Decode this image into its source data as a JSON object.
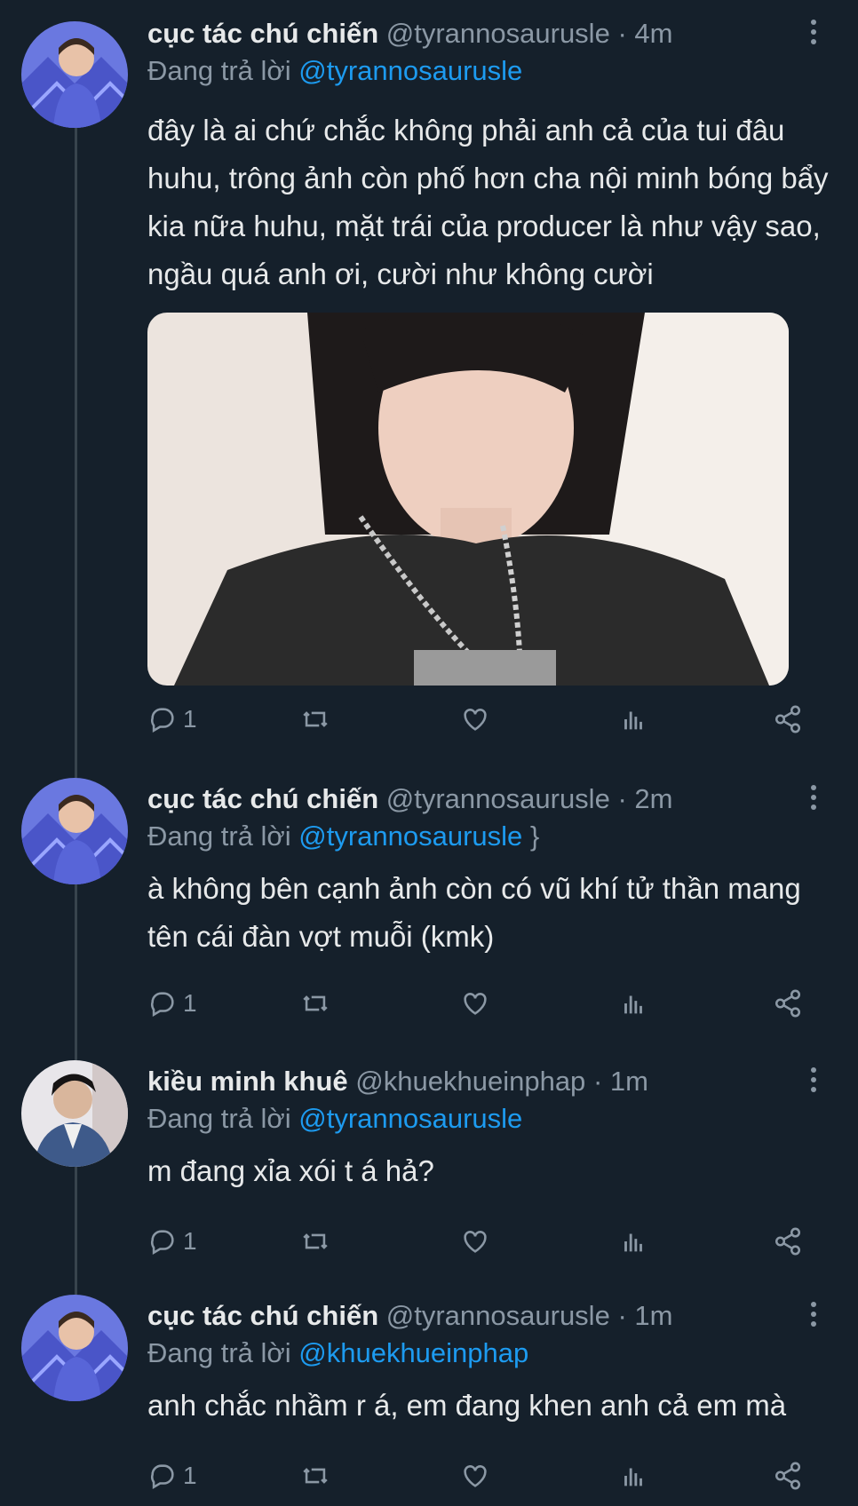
{
  "tweets": [
    {
      "name": "cục tác chú chiến",
      "handle": "@tyrannosaurusle",
      "separator": "·",
      "time": "4m",
      "reply_prefix": "Đang trả lời",
      "reply_to": "@tyrannosaurusle",
      "text": "đây là ai chứ chắc không phải anh cả của tui đâu huhu, trông ảnh còn phố hơn cha nội minh bóng bẩy kia nữa huhu, mặt trái của producer là như vậy sao, ngầu quá anh ơi, cười như không cười",
      "has_media": true,
      "reply_count": "1"
    },
    {
      "name": "cục tác chú chiến",
      "handle": "@tyrannosaurusle",
      "separator": "·",
      "time": "2m",
      "reply_prefix": "Đang trả lời",
      "reply_to": "@tyrannosaurusle",
      "text": "à không bên cạnh ảnh còn có vũ khí tử thần mang tên cái đàn vợt muỗi (kmk)",
      "has_media": false,
      "reply_count": "1"
    },
    {
      "name": "kiều minh khuê",
      "handle": "@khuekhueinphap",
      "separator": "·",
      "time": "1m",
      "reply_prefix": "Đang trả lời",
      "reply_to": "@tyrannosaurusle",
      "text": "m đang xỉa xói t á hả?",
      "has_media": false,
      "reply_count": "1"
    },
    {
      "name": "cục tác chú chiến",
      "handle": "@tyrannosaurusle",
      "separator": "·",
      "time": "1m",
      "reply_prefix": "Đang trả lời",
      "reply_to": "@khuekhueinphap",
      "text": "anh chắc nhầm r á, em đang khen anh cả em mà",
      "has_media": false,
      "reply_count": "1"
    }
  ],
  "colors": {
    "background": "#15202b",
    "text": "#e7e9ea",
    "secondary": "#8b98a5",
    "link": "#1d9bf0",
    "thread_line": "#38444d"
  },
  "icons": [
    "reply-icon",
    "retweet-icon",
    "like-icon",
    "analytics-icon",
    "share-icon",
    "more-icon"
  ]
}
